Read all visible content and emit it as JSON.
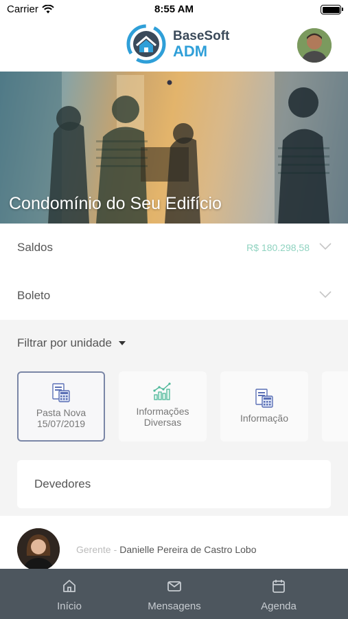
{
  "status_bar": {
    "carrier": "Carrier",
    "time": "8:55 AM"
  },
  "header": {
    "logo_line1": "BaseSoft",
    "logo_line2": "ADM",
    "brand_color": "#2f9fd8"
  },
  "hero": {
    "title": "Condomínio do Seu Edifício"
  },
  "saldos": {
    "label": "Saldos",
    "value": "R$ 180.298,58"
  },
  "boleto": {
    "label": "Boleto"
  },
  "filter": {
    "label": "Filtrar por unidade"
  },
  "cards": [
    {
      "line1": "Pasta Nova",
      "line2": "15/07/2019",
      "icon": "calculator-document-icon"
    },
    {
      "line1": "Informações",
      "line2": "Diversas",
      "icon": "growth-chart-icon"
    },
    {
      "line1": "Informação",
      "line2": "",
      "icon": "calculator-document-icon"
    }
  ],
  "devedores": {
    "label": "Devedores"
  },
  "manager": {
    "role": "Gerente",
    "separator": "-",
    "name": "Danielle Pereira de Castro Lobo"
  },
  "tabbar": {
    "items": [
      {
        "label": "Início",
        "icon": "home-icon"
      },
      {
        "label": "Mensagens",
        "icon": "mail-icon"
      },
      {
        "label": "Agenda",
        "icon": "calendar-icon"
      }
    ]
  },
  "colors": {
    "accent_value": "#8fd3c0",
    "tabbar_bg": "#4d565e"
  }
}
